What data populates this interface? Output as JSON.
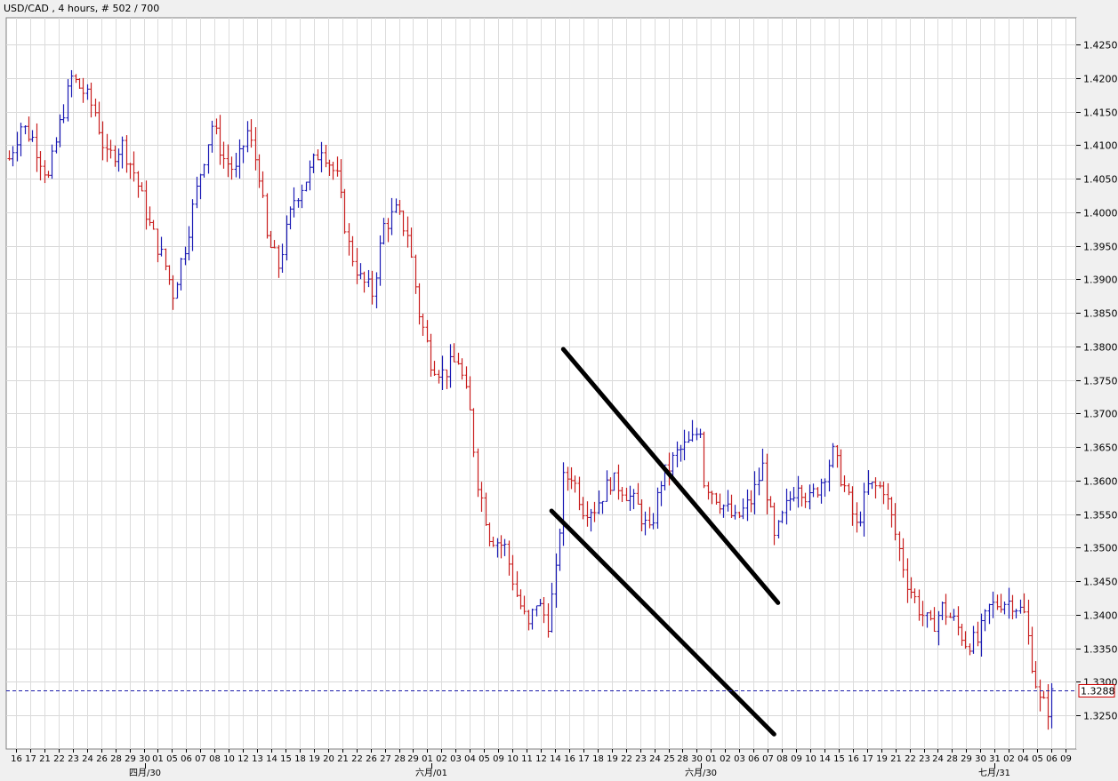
{
  "chart_data": {
    "type": "ohlc",
    "title": "USD/CAD , 4 hours, # 502 / 700",
    "symbol": "USD/CAD",
    "timeframe": "4 hours",
    "ylim": [
      1.32,
      1.429
    ],
    "yticks": [
      "1.4250",
      "1.4200",
      "1.4150",
      "1.4100",
      "1.4050",
      "1.4000",
      "1.3950",
      "1.3900",
      "1.3850",
      "1.3800",
      "1.3750",
      "1.3700",
      "1.3650",
      "1.3600",
      "1.3550",
      "1.3500",
      "1.3450",
      "1.3400",
      "1.3350",
      "1.3300",
      "1.3250"
    ],
    "current_price": 1.3288,
    "current_price_label": "1.3288",
    "x_date_labels": [
      "16",
      "17",
      "21",
      "22",
      "23",
      "24",
      "26",
      "28",
      "29",
      "30",
      "01",
      "05",
      "06",
      "07",
      "08",
      "10",
      "12",
      "13",
      "14",
      "15",
      "18",
      "19",
      "20",
      "21",
      "22",
      "26",
      "27",
      "28",
      "29",
      "01",
      "02",
      "03",
      "04",
      "05",
      "09",
      "10",
      "11",
      "12",
      "14",
      "16",
      "17",
      "18",
      "19",
      "22",
      "23",
      "24",
      "25",
      "28",
      "30",
      "01",
      "02",
      "03",
      "06",
      "07",
      "08",
      "09",
      "10",
      "14",
      "15",
      "16",
      "17",
      "19",
      "21",
      "22",
      "23",
      "24",
      "28",
      "29",
      "30",
      "31",
      "02",
      "04",
      "05",
      "06",
      "09"
    ],
    "x_month_labels": [
      "四月/30",
      "六月/01",
      "六月/30",
      "七月/31"
    ],
    "grid": true,
    "bar_count": 178,
    "price_path": [
      [
        0,
        1.408
      ],
      [
        3,
        1.413
      ],
      [
        6,
        1.411
      ],
      [
        10,
        1.405
      ],
      [
        13,
        1.413
      ],
      [
        16,
        1.42
      ],
      [
        19,
        1.418
      ],
      [
        22,
        1.415
      ],
      [
        25,
        1.408
      ],
      [
        29,
        1.41
      ],
      [
        32,
        1.406
      ],
      [
        36,
        1.398
      ],
      [
        40,
        1.392
      ],
      [
        42,
        1.388
      ],
      [
        45,
        1.395
      ],
      [
        49,
        1.406
      ],
      [
        52,
        1.413
      ],
      [
        55,
        1.408
      ],
      [
        58,
        1.406
      ],
      [
        61,
        1.412
      ],
      [
        64,
        1.406
      ],
      [
        66,
        1.396
      ],
      [
        69,
        1.392
      ],
      [
        73,
        1.402
      ],
      [
        77,
        1.406
      ],
      [
        80,
        1.41
      ],
      [
        84,
        1.405
      ],
      [
        87,
        1.395
      ],
      [
        90,
        1.39
      ],
      [
        93,
        1.388
      ],
      [
        96,
        1.398
      ],
      [
        99,
        1.4
      ],
      [
        102,
        1.397
      ],
      [
        105,
        1.385
      ],
      [
        108,
        1.378
      ],
      [
        111,
        1.376
      ],
      [
        115,
        1.378
      ],
      [
        118,
        1.37
      ],
      [
        120,
        1.36
      ],
      [
        123,
        1.352
      ],
      [
        127,
        1.35
      ],
      [
        130,
        1.343
      ],
      [
        133,
        1.338
      ],
      [
        135,
        1.342
      ],
      [
        138,
        1.339
      ],
      [
        140,
        1.346
      ],
      [
        142,
        1.36
      ],
      [
        144,
        1.361
      ],
      [
        147,
        1.356
      ],
      [
        150,
        1.356
      ],
      [
        154,
        1.36
      ],
      [
        157,
        1.359
      ],
      [
        161,
        1.356
      ],
      [
        164,
        1.352
      ],
      [
        167,
        1.36
      ],
      [
        171,
        1.364
      ],
      [
        175,
        1.366
      ],
      [
        177,
        1.368
      ]
    ],
    "price_path_2": [
      [
        0,
        1.36
      ],
      [
        4,
        1.357
      ],
      [
        8,
        1.354
      ],
      [
        12,
        1.357
      ],
      [
        15,
        1.362
      ],
      [
        18,
        1.351
      ],
      [
        21,
        1.356
      ],
      [
        24,
        1.36
      ],
      [
        27,
        1.357
      ],
      [
        30,
        1.36
      ],
      [
        33,
        1.364
      ],
      [
        36,
        1.359
      ],
      [
        39,
        1.353
      ],
      [
        42,
        1.359
      ],
      [
        46,
        1.359
      ],
      [
        49,
        1.352
      ],
      [
        52,
        1.345
      ],
      [
        55,
        1.341
      ],
      [
        58,
        1.338
      ],
      [
        61,
        1.341
      ],
      [
        64,
        1.339
      ],
      [
        67,
        1.336
      ],
      [
        70,
        1.336
      ],
      [
        73,
        1.341
      ],
      [
        76,
        1.342
      ],
      [
        79,
        1.342
      ],
      [
        82,
        1.34
      ],
      [
        84,
        1.333
      ],
      [
        86,
        1.327
      ],
      [
        88,
        1.326
      ],
      [
        89,
        1.328
      ]
    ],
    "trendlines": [
      {
        "name": "upper",
        "x0_bar": 142,
        "y0": 1.3796,
        "x1_bar": 197,
        "y1": 1.3418
      },
      {
        "name": "lower",
        "x0_bar": 139,
        "y0": 1.3555,
        "x1_bar": 196,
        "y1": 1.3222
      }
    ]
  }
}
